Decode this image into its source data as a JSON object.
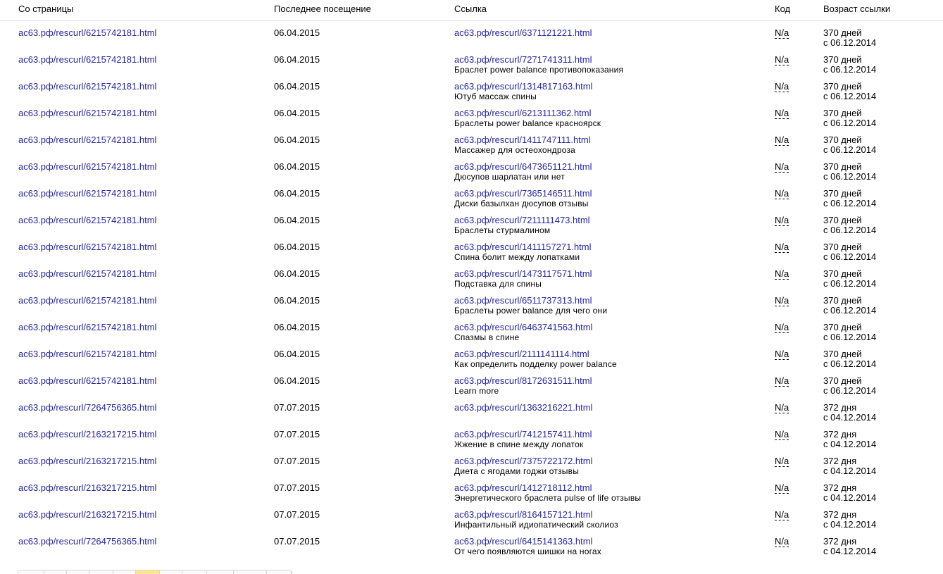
{
  "header": {
    "from": "Со страницы",
    "visited": "Последнее посещение",
    "link": "Ссылка",
    "code": "Код",
    "age": "Возраст ссылки"
  },
  "rows": [
    {
      "from": "ас63.рф/rescurl/6215742181.html",
      "date": "06.04.2015",
      "link": "ас63.рф/rescurl/6371121221.html",
      "anchor": "",
      "code": "N/a",
      "age": "370 дней",
      "since": "с 06.12.2014"
    },
    {
      "from": "ас63.рф/rescurl/6215742181.html",
      "date": "06.04.2015",
      "link": "ас63.рф/rescurl/7271741311.html",
      "anchor": "Браслет power balance противопоказания",
      "code": "N/a",
      "age": "370 дней",
      "since": "с 06.12.2014"
    },
    {
      "from": "ас63.рф/rescurl/6215742181.html",
      "date": "06.04.2015",
      "link": "ас63.рф/rescurl/1314817163.html",
      "anchor": "Ютуб массаж спины",
      "code": "N/a",
      "age": "370 дней",
      "since": "с 06.12.2014"
    },
    {
      "from": "ас63.рф/rescurl/6215742181.html",
      "date": "06.04.2015",
      "link": "ас63.рф/rescurl/6213111362.html",
      "anchor": "Браслеты power balance красноярск",
      "code": "N/a",
      "age": "370 дней",
      "since": "с 06.12.2014"
    },
    {
      "from": "ас63.рф/rescurl/6215742181.html",
      "date": "06.04.2015",
      "link": "ас63.рф/rescurl/1411747111.html",
      "anchor": "Массажер для остеохондроза",
      "code": "N/a",
      "age": "370 дней",
      "since": "с 06.12.2014"
    },
    {
      "from": "ас63.рф/rescurl/6215742181.html",
      "date": "06.04.2015",
      "link": "ас63.рф/rescurl/6473651121.html",
      "anchor": "Дюсупов шарлатан или нет",
      "code": "N/a",
      "age": "370 дней",
      "since": "с 06.12.2014"
    },
    {
      "from": "ас63.рф/rescurl/6215742181.html",
      "date": "06.04.2015",
      "link": "ас63.рф/rescurl/7365146511.html",
      "anchor": "Диски базылхан дюсупов отзывы",
      "code": "N/a",
      "age": "370 дней",
      "since": "с 06.12.2014"
    },
    {
      "from": "ас63.рф/rescurl/6215742181.html",
      "date": "06.04.2015",
      "link": "ас63.рф/rescurl/7211111473.html",
      "anchor": "Браслеты стурмалином",
      "code": "N/a",
      "age": "370 дней",
      "since": "с 06.12.2014"
    },
    {
      "from": "ас63.рф/rescurl/6215742181.html",
      "date": "06.04.2015",
      "link": "ас63.рф/rescurl/1411157271.html",
      "anchor": "Спина болит между лопатками",
      "code": "N/a",
      "age": "370 дней",
      "since": "с 06.12.2014"
    },
    {
      "from": "ас63.рф/rescurl/6215742181.html",
      "date": "06.04.2015",
      "link": "ас63.рф/rescurl/1473117571.html",
      "anchor": "Подставка для спины",
      "code": "N/a",
      "age": "370 дней",
      "since": "с 06.12.2014"
    },
    {
      "from": "ас63.рф/rescurl/6215742181.html",
      "date": "06.04.2015",
      "link": "ас63.рф/rescurl/6511737313.html",
      "anchor": "Браслеты power balance для чего они",
      "code": "N/a",
      "age": "370 дней",
      "since": "с 06.12.2014"
    },
    {
      "from": "ас63.рф/rescurl/6215742181.html",
      "date": "06.04.2015",
      "link": "ас63.рф/rescurl/6463741563.html",
      "anchor": "Спазмы в спине",
      "code": "N/a",
      "age": "370 дней",
      "since": "с 06.12.2014"
    },
    {
      "from": "ас63.рф/rescurl/6215742181.html",
      "date": "06.04.2015",
      "link": "ас63.рф/rescurl/2111141114.html",
      "anchor": "Как определить подделку power balance",
      "code": "N/a",
      "age": "370 дней",
      "since": "с 06.12.2014"
    },
    {
      "from": "ас63.рф/rescurl/6215742181.html",
      "date": "06.04.2015",
      "link": "ас63.рф/rescurl/8172631511.html",
      "anchor": "Learn more",
      "code": "N/a",
      "age": "370 дней",
      "since": "с 06.12.2014"
    },
    {
      "from": "ас63.рф/rescurl/7264756365.html",
      "date": "07.07.2015",
      "link": "ас63.рф/rescurl/1363216221.html",
      "anchor": "",
      "code": "N/a",
      "age": "372 дня",
      "since": "с 04.12.2014"
    },
    {
      "from": "ас63.рф/rescurl/2163217215.html",
      "date": "07.07.2015",
      "link": "ас63.рф/rescurl/7412157411.html",
      "anchor": "Жжение в спине между лопаток",
      "code": "N/a",
      "age": "372 дня",
      "since": "с 04.12.2014"
    },
    {
      "from": "ас63.рф/rescurl/2163217215.html",
      "date": "07.07.2015",
      "link": "ас63.рф/rescurl/7375722172.html",
      "anchor": "Диета с ягодами годжи отзывы",
      "code": "N/a",
      "age": "372 дня",
      "since": "с 04.12.2014"
    },
    {
      "from": "ас63.рф/rescurl/2163217215.html",
      "date": "07.07.2015",
      "link": "ас63.рф/rescurl/1412718112.html",
      "anchor": "Энергетического браслета pulse of life отзывы",
      "code": "N/a",
      "age": "372 дня",
      "since": "с 04.12.2014"
    },
    {
      "from": "ас63.рф/rescurl/2163217215.html",
      "date": "07.07.2015",
      "link": "ас63.рф/rescurl/8164157121.html",
      "anchor": "Инфантильный идиопатический сколиоз",
      "code": "N/a",
      "age": "372 дня",
      "since": "с 04.12.2014"
    },
    {
      "from": "ас63.рф/rescurl/7264756365.html",
      "date": "07.07.2015",
      "link": "ас63.рф/rescurl/6415141363.html",
      "anchor": "От чего появляются шишки на ногах",
      "code": "N/a",
      "age": "372 дня",
      "since": "с 04.12.2014"
    }
  ],
  "pager": {
    "active_index": 5,
    "colors": {
      "active": "#fce58a",
      "normal": "#fafafa"
    }
  },
  "colors": {
    "link": "#2626a3",
    "text": "#000000",
    "divider": "#e4e4e4"
  }
}
